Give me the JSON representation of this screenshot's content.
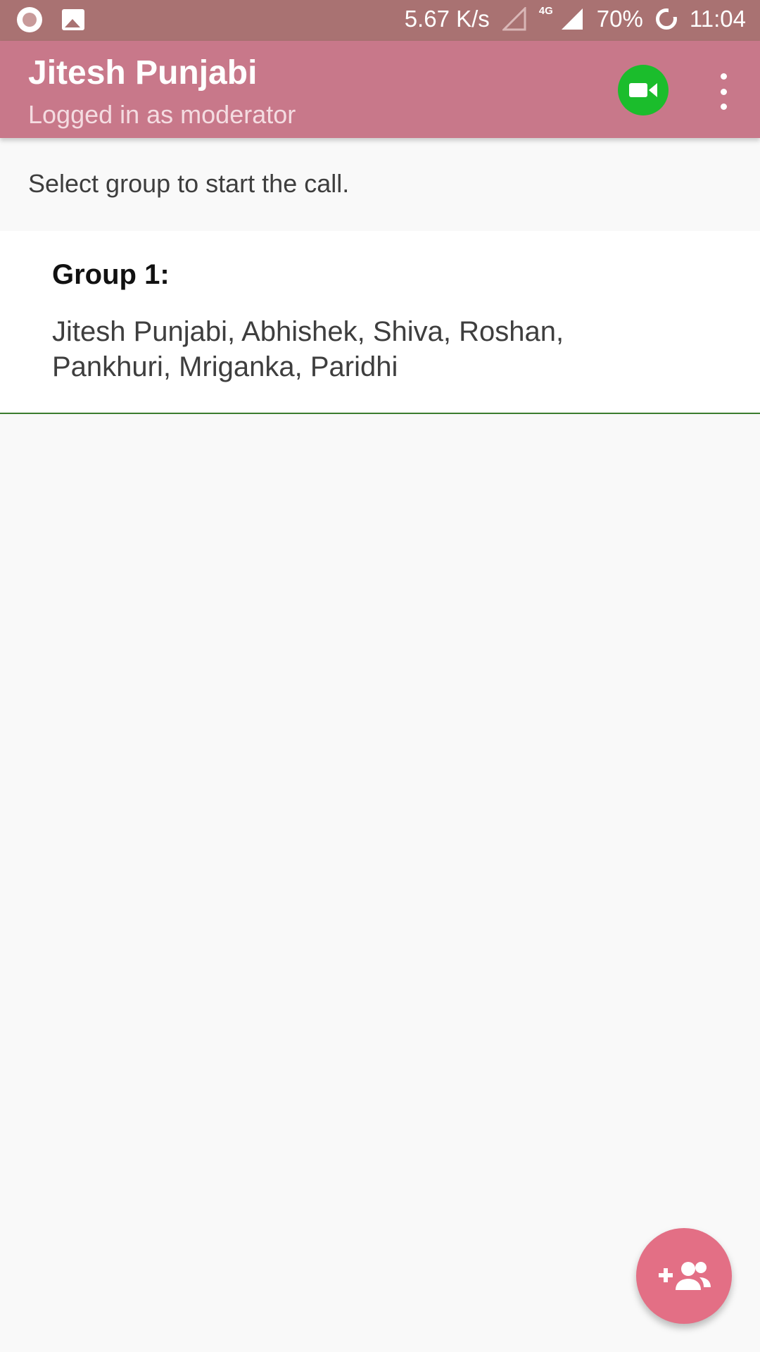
{
  "status_bar": {
    "net_speed": "5.67 K/s",
    "network_type": "4G",
    "battery": "70%",
    "time": "11:04",
    "icons": [
      "app-notification-icon",
      "image-icon",
      "signal-empty-icon",
      "signal-full-icon",
      "battery-icon"
    ]
  },
  "app_bar": {
    "title": "Jitesh Punjabi",
    "subtitle": "Logged in as moderator",
    "video_icon": "video-camera-icon",
    "menu_icon": "more-vert-icon",
    "colors": {
      "bar": "#c8788a",
      "video_button": "#1bbd2c"
    }
  },
  "main": {
    "instruction": "Select group to start the call.",
    "groups": [
      {
        "title": "Group 1:",
        "members": "Jitesh Punjabi, Abhishek, Shiva, Roshan, Pankhuri, Mriganka, Paridhi"
      }
    ]
  },
  "fab": {
    "icon": "add-group-icon",
    "color": "#e36f85"
  }
}
